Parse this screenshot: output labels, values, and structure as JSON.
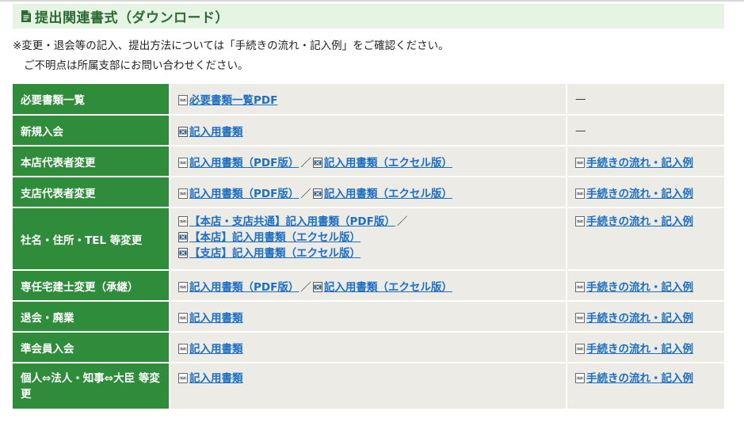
{
  "header": {
    "title": "提出関連書式（ダウンロード）"
  },
  "notes": [
    "※変更・退会等の記入、提出方法については「手続きの流れ・記入例」をご確認ください。",
    "ご不明点は所属支部にお問い合わせください。"
  ],
  "separator": "／",
  "dash": "—",
  "rows": [
    {
      "label": "必要書類一覧",
      "docs": [
        "必要書類一覧PDF"
      ],
      "flow": "—"
    },
    {
      "label": "新規入会",
      "docs": [
        "記入用書類"
      ],
      "flow": "—"
    },
    {
      "label": "本店代表者変更",
      "docs": [
        "記入用書類（PDF版）",
        "記入用書類（エクセル版）"
      ],
      "flow": "手続きの流れ・記入例"
    },
    {
      "label": "支店代表者変更",
      "docs": [
        "記入用書類（PDF版）",
        "記入用書類（エクセル版）"
      ],
      "flow": "手続きの流れ・記入例"
    },
    {
      "label": "社名・住所・TEL 等変更",
      "docs": [
        "【本店・支店共通】記入用書類（PDF版）",
        "【本店】記入用書類（エクセル版）",
        "【支店】記入用書類（エクセル版）"
      ],
      "flow": "手続きの流れ・記入例"
    },
    {
      "label": "専任宅建士変更（承継）",
      "docs": [
        "記入用書類（PDF版）",
        "記入用書類（エクセル版）"
      ],
      "flow": "手続きの流れ・記入例"
    },
    {
      "label": "退会・廃業",
      "docs": [
        "記入用書類"
      ],
      "flow": "手続きの流れ・記入例"
    },
    {
      "label": "準会員入会",
      "docs": [
        "記入用書類"
      ],
      "flow": "手続きの流れ・記入例"
    },
    {
      "label": "個人⇔法人・知事⇔大臣 等変更",
      "docs": [
        "記入用書類"
      ],
      "flow": "手続きの流れ・記入例"
    }
  ],
  "colors": {
    "label_bg": "#2f8c3a",
    "cell_bg": "#ecebe6",
    "link": "#1c6fc4",
    "header_bg": "#e6f5e3",
    "header_text": "#2b6a32"
  }
}
